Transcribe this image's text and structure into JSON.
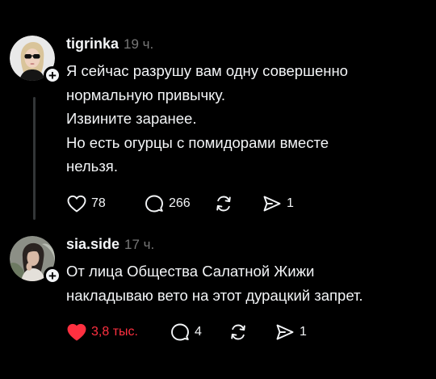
{
  "colors": {
    "background": "#000000",
    "text": "#f3f5f7",
    "muted": "#777777",
    "like_active": "#ff3040",
    "thread_line": "#333638"
  },
  "posts": [
    {
      "username": "tigrinka",
      "time": "19 ч.",
      "avatar": "avatar-woman-sunglasses",
      "lines": [
        "Я сейчас разрушу вам одну совершенно",
        "нормальную привычку.",
        "Извините заранее.",
        "Но есть огурцы с помидорами вместе",
        "нельзя."
      ],
      "likes": "78",
      "replies": "266",
      "shares": "1",
      "liked": false
    },
    {
      "username": "sia.side",
      "time": "17 ч.",
      "avatar": "avatar-woman-dark-hair",
      "lines": [
        "От лица Общества Салатной Жижи",
        "накладываю вето на этот дурацкий запрет."
      ],
      "likes": "3,8 тыс.",
      "replies": "4",
      "shares": "1",
      "liked": true
    }
  ]
}
